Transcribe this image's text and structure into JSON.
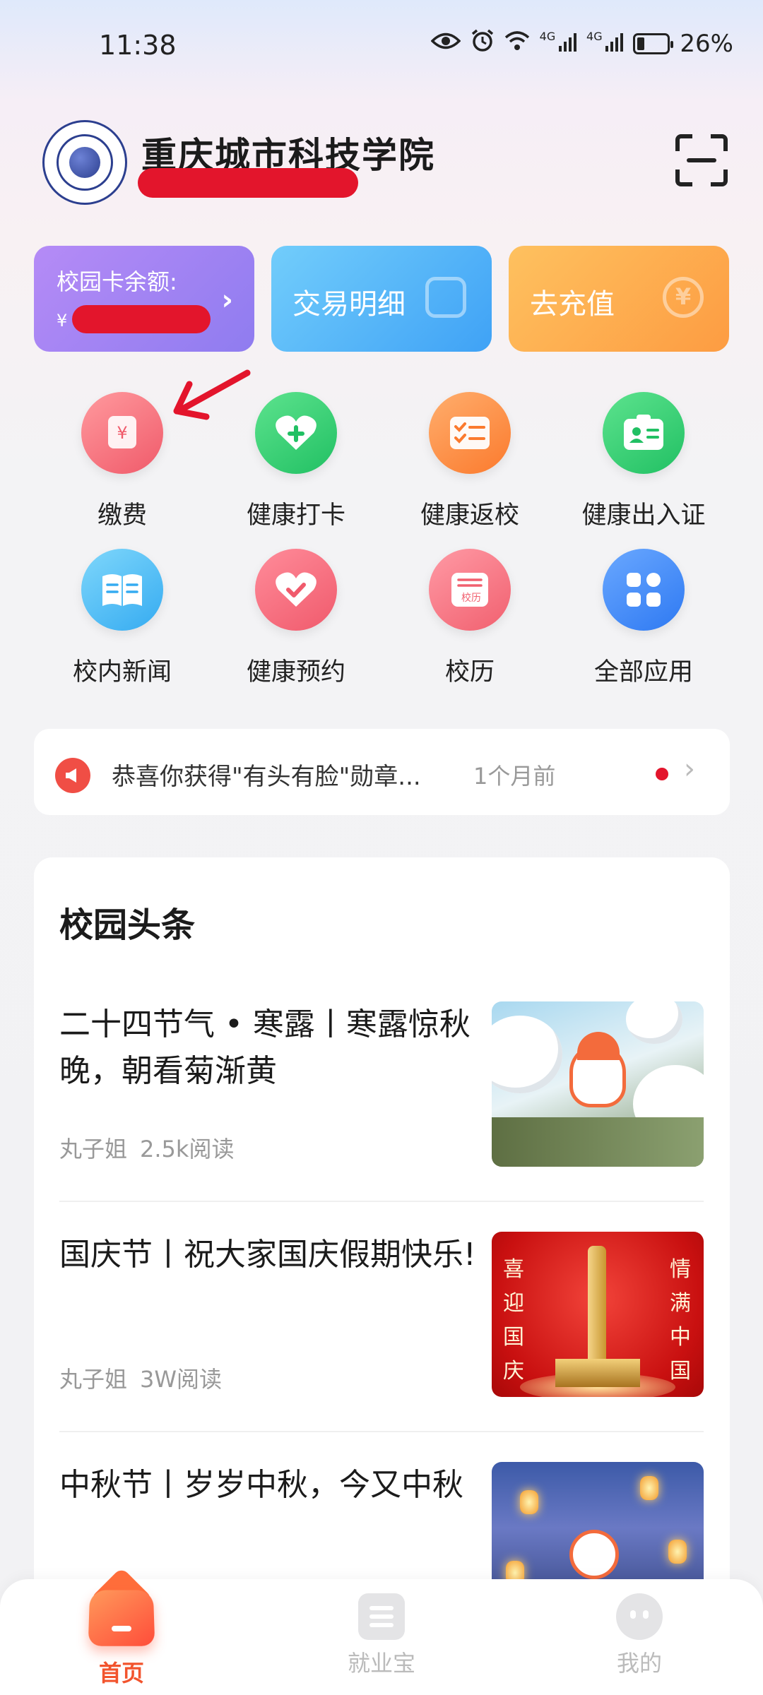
{
  "status_bar": {
    "time": "11:38",
    "battery_text": "26%",
    "battery_level": 0.26,
    "net1": "4G",
    "net2": "4G",
    "icons": [
      "eye-icon",
      "alarm-icon",
      "wifi-icon",
      "signal-icon",
      "signal-icon",
      "battery-icon"
    ]
  },
  "header": {
    "school_name": "重庆城市科技学院",
    "scan_icon": "scan-icon"
  },
  "cards": {
    "balance_label": "校园卡余额:",
    "balance_currency": "¥",
    "transactions_label": "交易明细",
    "recharge_label": "去充值",
    "recharge_symbol": "¥"
  },
  "apps": [
    {
      "label": "缴费",
      "icon": "payment-receipt-icon",
      "color": "#f05a6a"
    },
    {
      "label": "健康打卡",
      "icon": "heart-plus-icon",
      "color": "#21c063"
    },
    {
      "label": "健康返校",
      "icon": "checklist-icon",
      "color": "#fb7a2d"
    },
    {
      "label": "健康出入证",
      "icon": "id-card-icon",
      "color": "#21c063"
    },
    {
      "label": "校内新闻",
      "icon": "book-icon",
      "color": "#35abf1"
    },
    {
      "label": "健康预约",
      "icon": "heart-check-icon",
      "color": "#f05a6c"
    },
    {
      "label": "校历",
      "icon": "calendar-icon",
      "color": "#f1606f",
      "icon_text": "校历"
    },
    {
      "label": "全部应用",
      "icon": "grid-apps-icon",
      "color": "#2e79f2"
    }
  ],
  "notice": {
    "text": "恭喜你获得\"有头有脸\"勋章...",
    "time": "1个月前"
  },
  "news": {
    "section_title": "校园头条",
    "articles": [
      {
        "title": "二十四节气 • 寒露丨寒露惊秋晚，朝看菊渐黄",
        "author": "丸子姐",
        "reads": "2.5k阅读"
      },
      {
        "title": "国庆节丨祝大家国庆假期快乐!",
        "author": "丸子姐",
        "reads": "3W阅读",
        "thumb_left": "喜迎国庆",
        "thumb_right": "情满中国"
      },
      {
        "title": "中秋节丨岁岁中秋，今又中秋"
      }
    ]
  },
  "tabbar": {
    "tabs": [
      {
        "label": "首页",
        "active": true
      },
      {
        "label": "就业宝",
        "active": false
      },
      {
        "label": "我的",
        "active": false
      }
    ]
  },
  "colors": {
    "accent": "#f2542d",
    "redaction": "#e3152c",
    "card_purple": "#8f7cf0",
    "card_blue": "#3fa2f6",
    "card_orange": "#fd9c42"
  }
}
